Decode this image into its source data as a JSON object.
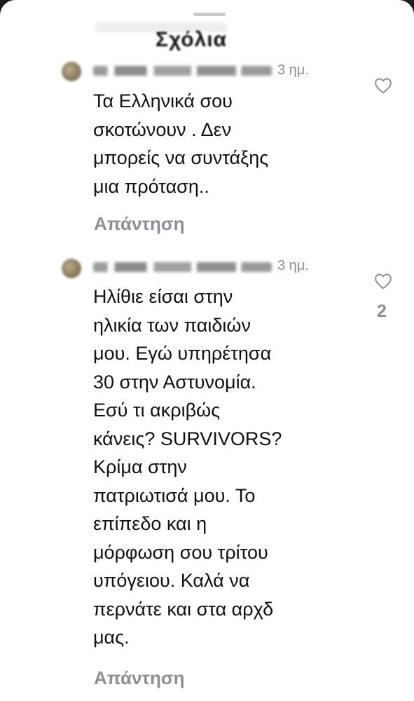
{
  "sheet": {
    "title": "Σχόλια"
  },
  "comments": [
    {
      "username": "",
      "time": "3 ημ.",
      "text": "Τα Ελληνικά σου\nσκοτώνουν . Δεν\nμπορείς να συντάξης\nμια πρόταση..",
      "reply_label": "Απάντηση",
      "like_count": "",
      "icon": "heart-outline"
    },
    {
      "username": "",
      "time": "3 ημ.",
      "text": "Ηλίθιε είσαι στην\nηλικία των παιδιών\nμου. Εγώ υπηρέτησα\n30 στην Αστυνομία.\nΕσύ τι ακριβώς\nκάνεις? SURVIVORS?\nΚρίμα στην\nπατριωτισά μου. Το\nεπίπεδο και η\nμόρφωση σου τρίτου\nυπόγειου. Καλά να\nπερνάτε και στα αρχδ\nμας.",
      "reply_label": "Απάντηση",
      "like_count": "2",
      "icon": "heart-outline"
    }
  ],
  "colors": {
    "background": "#ffffff",
    "text": "#111111",
    "secondary": "#8e8e93"
  }
}
